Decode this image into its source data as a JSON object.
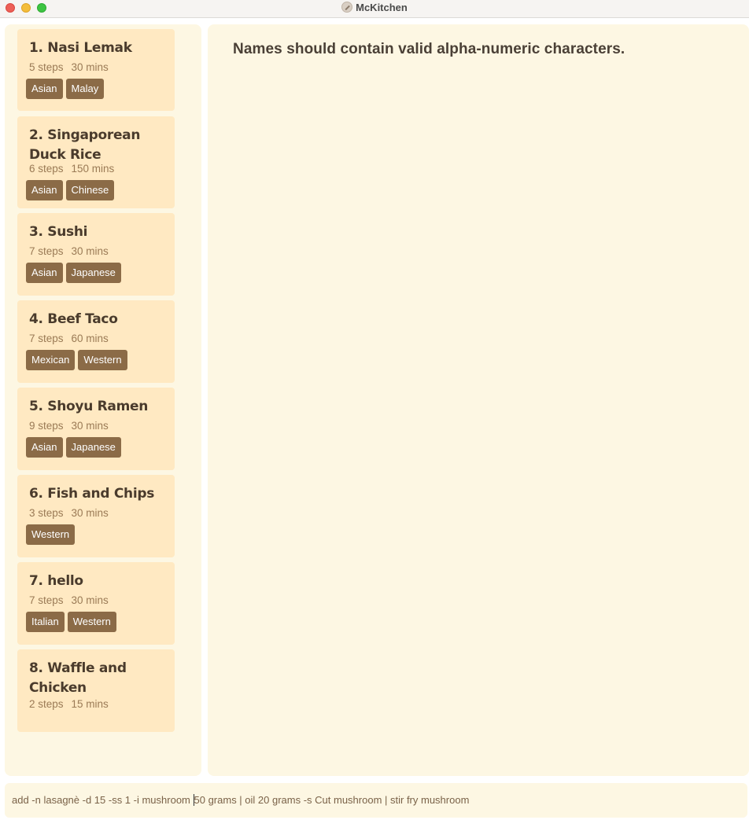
{
  "window": {
    "title": "McKitchen"
  },
  "recipes": [
    {
      "title": "1. Nasi Lemak",
      "steps": "5 steps",
      "time": "30 mins",
      "tags": [
        "Asian",
        "Malay"
      ]
    },
    {
      "title": "2. Singaporean Duck Rice",
      "steps": "6 steps",
      "time": "150 mins",
      "tags": [
        "Asian",
        "Chinese"
      ]
    },
    {
      "title": "3. Sushi",
      "steps": "7 steps",
      "time": "30 mins",
      "tags": [
        "Asian",
        "Japanese"
      ]
    },
    {
      "title": "4. Beef Taco",
      "steps": "7 steps",
      "time": "60 mins",
      "tags": [
        "Mexican",
        "Western"
      ]
    },
    {
      "title": "5. Shoyu Ramen",
      "steps": "9 steps",
      "time": "30 mins",
      "tags": [
        "Asian",
        "Japanese"
      ]
    },
    {
      "title": "6. Fish and Chips",
      "steps": "3 steps",
      "time": "30 mins",
      "tags": [
        "Western"
      ]
    },
    {
      "title": "7. hello",
      "steps": "7 steps",
      "time": "30 mins",
      "tags": [
        "Italian",
        "Western"
      ]
    },
    {
      "title": "8. Waffle and Chicken",
      "steps": "2 steps",
      "time": "15 mins",
      "tags": []
    }
  ],
  "result": {
    "message": "Names should contain valid alpha-numeric characters."
  },
  "command": {
    "before_caret": "add -n lasagnè -d 15 -ss 1 -i mushroom ",
    "after_caret": "50 grams | oil 20 grams -s Cut mushroom | stir fry mushroom"
  }
}
